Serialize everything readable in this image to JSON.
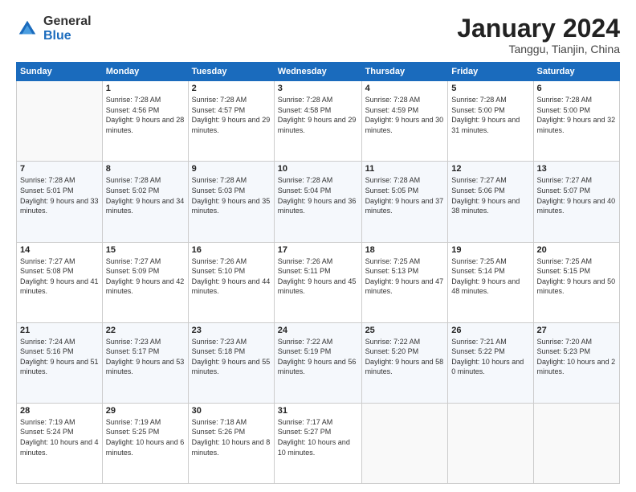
{
  "logo": {
    "general": "General",
    "blue": "Blue"
  },
  "title": "January 2024",
  "location": "Tanggu, Tianjin, China",
  "days_of_week": [
    "Sunday",
    "Monday",
    "Tuesday",
    "Wednesday",
    "Thursday",
    "Friday",
    "Saturday"
  ],
  "weeks": [
    [
      {
        "day": "",
        "sunrise": "",
        "sunset": "",
        "daylight": ""
      },
      {
        "day": "1",
        "sunrise": "Sunrise: 7:28 AM",
        "sunset": "Sunset: 4:56 PM",
        "daylight": "Daylight: 9 hours and 28 minutes."
      },
      {
        "day": "2",
        "sunrise": "Sunrise: 7:28 AM",
        "sunset": "Sunset: 4:57 PM",
        "daylight": "Daylight: 9 hours and 29 minutes."
      },
      {
        "day": "3",
        "sunrise": "Sunrise: 7:28 AM",
        "sunset": "Sunset: 4:58 PM",
        "daylight": "Daylight: 9 hours and 29 minutes."
      },
      {
        "day": "4",
        "sunrise": "Sunrise: 7:28 AM",
        "sunset": "Sunset: 4:59 PM",
        "daylight": "Daylight: 9 hours and 30 minutes."
      },
      {
        "day": "5",
        "sunrise": "Sunrise: 7:28 AM",
        "sunset": "Sunset: 5:00 PM",
        "daylight": "Daylight: 9 hours and 31 minutes."
      },
      {
        "day": "6",
        "sunrise": "Sunrise: 7:28 AM",
        "sunset": "Sunset: 5:00 PM",
        "daylight": "Daylight: 9 hours and 32 minutes."
      }
    ],
    [
      {
        "day": "7",
        "sunrise": "Sunrise: 7:28 AM",
        "sunset": "Sunset: 5:01 PM",
        "daylight": "Daylight: 9 hours and 33 minutes."
      },
      {
        "day": "8",
        "sunrise": "Sunrise: 7:28 AM",
        "sunset": "Sunset: 5:02 PM",
        "daylight": "Daylight: 9 hours and 34 minutes."
      },
      {
        "day": "9",
        "sunrise": "Sunrise: 7:28 AM",
        "sunset": "Sunset: 5:03 PM",
        "daylight": "Daylight: 9 hours and 35 minutes."
      },
      {
        "day": "10",
        "sunrise": "Sunrise: 7:28 AM",
        "sunset": "Sunset: 5:04 PM",
        "daylight": "Daylight: 9 hours and 36 minutes."
      },
      {
        "day": "11",
        "sunrise": "Sunrise: 7:28 AM",
        "sunset": "Sunset: 5:05 PM",
        "daylight": "Daylight: 9 hours and 37 minutes."
      },
      {
        "day": "12",
        "sunrise": "Sunrise: 7:27 AM",
        "sunset": "Sunset: 5:06 PM",
        "daylight": "Daylight: 9 hours and 38 minutes."
      },
      {
        "day": "13",
        "sunrise": "Sunrise: 7:27 AM",
        "sunset": "Sunset: 5:07 PM",
        "daylight": "Daylight: 9 hours and 40 minutes."
      }
    ],
    [
      {
        "day": "14",
        "sunrise": "Sunrise: 7:27 AM",
        "sunset": "Sunset: 5:08 PM",
        "daylight": "Daylight: 9 hours and 41 minutes."
      },
      {
        "day": "15",
        "sunrise": "Sunrise: 7:27 AM",
        "sunset": "Sunset: 5:09 PM",
        "daylight": "Daylight: 9 hours and 42 minutes."
      },
      {
        "day": "16",
        "sunrise": "Sunrise: 7:26 AM",
        "sunset": "Sunset: 5:10 PM",
        "daylight": "Daylight: 9 hours and 44 minutes."
      },
      {
        "day": "17",
        "sunrise": "Sunrise: 7:26 AM",
        "sunset": "Sunset: 5:11 PM",
        "daylight": "Daylight: 9 hours and 45 minutes."
      },
      {
        "day": "18",
        "sunrise": "Sunrise: 7:25 AM",
        "sunset": "Sunset: 5:13 PM",
        "daylight": "Daylight: 9 hours and 47 minutes."
      },
      {
        "day": "19",
        "sunrise": "Sunrise: 7:25 AM",
        "sunset": "Sunset: 5:14 PM",
        "daylight": "Daylight: 9 hours and 48 minutes."
      },
      {
        "day": "20",
        "sunrise": "Sunrise: 7:25 AM",
        "sunset": "Sunset: 5:15 PM",
        "daylight": "Daylight: 9 hours and 50 minutes."
      }
    ],
    [
      {
        "day": "21",
        "sunrise": "Sunrise: 7:24 AM",
        "sunset": "Sunset: 5:16 PM",
        "daylight": "Daylight: 9 hours and 51 minutes."
      },
      {
        "day": "22",
        "sunrise": "Sunrise: 7:23 AM",
        "sunset": "Sunset: 5:17 PM",
        "daylight": "Daylight: 9 hours and 53 minutes."
      },
      {
        "day": "23",
        "sunrise": "Sunrise: 7:23 AM",
        "sunset": "Sunset: 5:18 PM",
        "daylight": "Daylight: 9 hours and 55 minutes."
      },
      {
        "day": "24",
        "sunrise": "Sunrise: 7:22 AM",
        "sunset": "Sunset: 5:19 PM",
        "daylight": "Daylight: 9 hours and 56 minutes."
      },
      {
        "day": "25",
        "sunrise": "Sunrise: 7:22 AM",
        "sunset": "Sunset: 5:20 PM",
        "daylight": "Daylight: 9 hours and 58 minutes."
      },
      {
        "day": "26",
        "sunrise": "Sunrise: 7:21 AM",
        "sunset": "Sunset: 5:22 PM",
        "daylight": "Daylight: 10 hours and 0 minutes."
      },
      {
        "day": "27",
        "sunrise": "Sunrise: 7:20 AM",
        "sunset": "Sunset: 5:23 PM",
        "daylight": "Daylight: 10 hours and 2 minutes."
      }
    ],
    [
      {
        "day": "28",
        "sunrise": "Sunrise: 7:19 AM",
        "sunset": "Sunset: 5:24 PM",
        "daylight": "Daylight: 10 hours and 4 minutes."
      },
      {
        "day": "29",
        "sunrise": "Sunrise: 7:19 AM",
        "sunset": "Sunset: 5:25 PM",
        "daylight": "Daylight: 10 hours and 6 minutes."
      },
      {
        "day": "30",
        "sunrise": "Sunrise: 7:18 AM",
        "sunset": "Sunset: 5:26 PM",
        "daylight": "Daylight: 10 hours and 8 minutes."
      },
      {
        "day": "31",
        "sunrise": "Sunrise: 7:17 AM",
        "sunset": "Sunset: 5:27 PM",
        "daylight": "Daylight: 10 hours and 10 minutes."
      },
      {
        "day": "",
        "sunrise": "",
        "sunset": "",
        "daylight": ""
      },
      {
        "day": "",
        "sunrise": "",
        "sunset": "",
        "daylight": ""
      },
      {
        "day": "",
        "sunrise": "",
        "sunset": "",
        "daylight": ""
      }
    ]
  ]
}
